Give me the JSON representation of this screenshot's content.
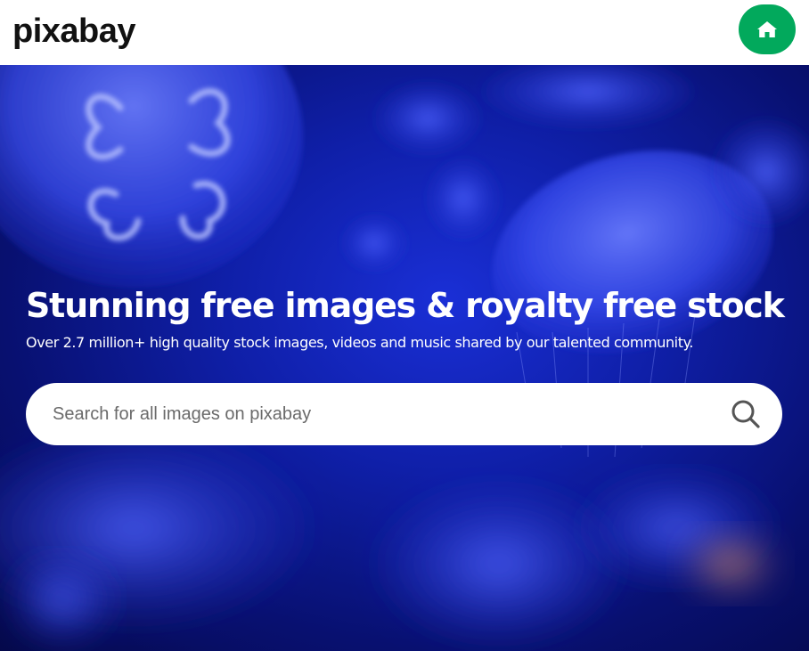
{
  "header": {
    "logo_text": "pixabay",
    "home_icon": "home-icon",
    "accent_color": "#02a95c"
  },
  "hero": {
    "title": "Stunning free images & royalty free stock",
    "subtitle": "Over 2.7 million+ high quality stock images, videos and music shared by our talented community.",
    "background_color": "#0f1fa8"
  },
  "search": {
    "placeholder": "Search for all images on pixabay",
    "value": "",
    "icon": "search-icon"
  }
}
